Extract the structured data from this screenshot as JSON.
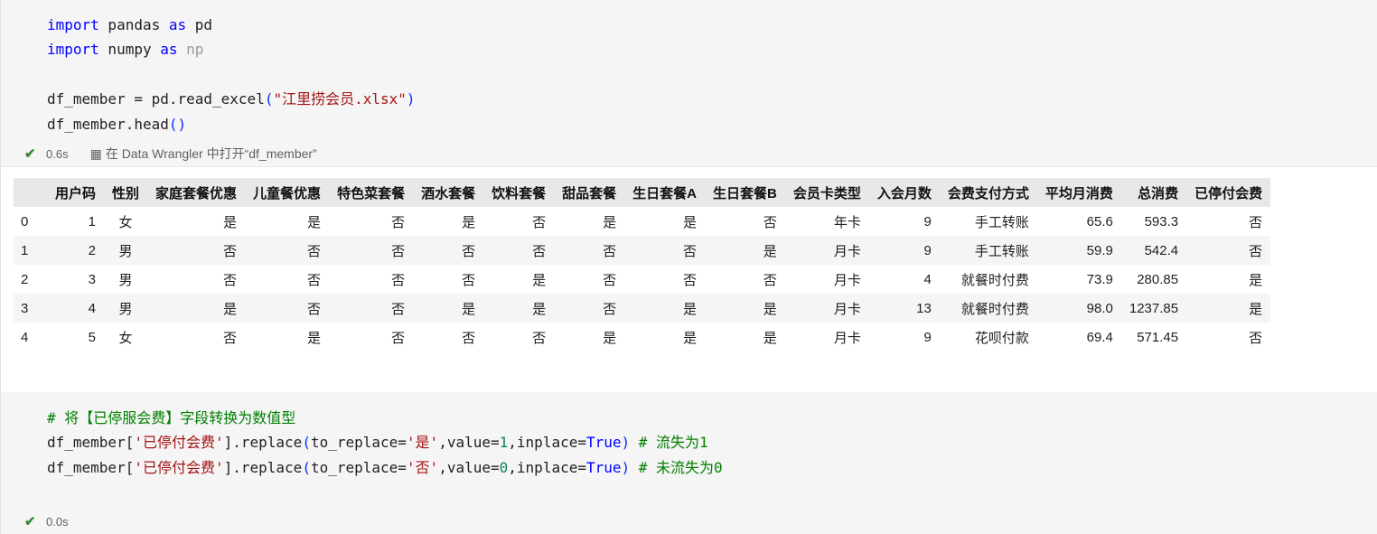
{
  "cell1": {
    "code": {
      "line1": {
        "kw1": "import",
        "mid": " pandas ",
        "kw2": "as",
        "tail": " pd"
      },
      "line2": {
        "kw1": "import",
        "mid": " numpy ",
        "kw2": "as",
        "tail": " np"
      },
      "line4": {
        "pre": "df_member = pd.read_excel",
        "open": "(",
        "str": "\"江里捞会员.xlsx\"",
        "close": ")"
      },
      "line5": {
        "pre": "df_member.head",
        "paren": "()"
      }
    },
    "status": {
      "time": "0.6s",
      "data_wrangler": "在 Data Wrangler 中打开“df_member”"
    }
  },
  "table": {
    "columns": [
      "",
      "用户码",
      "性别",
      "家庭套餐优惠",
      "儿童餐优惠",
      "特色菜套餐",
      "酒水套餐",
      "饮料套餐",
      "甜品套餐",
      "生日套餐A",
      "生日套餐B",
      "会员卡类型",
      "入会月数",
      "会费支付方式",
      "平均月消费",
      "总消费",
      "已停付会费"
    ],
    "rows": [
      [
        "0",
        "1",
        "女",
        "是",
        "是",
        "否",
        "是",
        "否",
        "是",
        "是",
        "否",
        "年卡",
        "9",
        "手工转账",
        "65.6",
        "593.3",
        "否"
      ],
      [
        "1",
        "2",
        "男",
        "否",
        "否",
        "否",
        "否",
        "否",
        "否",
        "否",
        "是",
        "月卡",
        "9",
        "手工转账",
        "59.9",
        "542.4",
        "否"
      ],
      [
        "2",
        "3",
        "男",
        "否",
        "否",
        "否",
        "否",
        "是",
        "否",
        "否",
        "否",
        "月卡",
        "4",
        "就餐时付费",
        "73.9",
        "280.85",
        "是"
      ],
      [
        "3",
        "4",
        "男",
        "是",
        "否",
        "否",
        "是",
        "是",
        "否",
        "是",
        "是",
        "月卡",
        "13",
        "就餐时付费",
        "98.0",
        "1237.85",
        "是"
      ],
      [
        "4",
        "5",
        "女",
        "否",
        "是",
        "否",
        "否",
        "否",
        "是",
        "是",
        "是",
        "月卡",
        "9",
        "花呗付款",
        "69.4",
        "571.45",
        "否"
      ]
    ]
  },
  "cell2": {
    "code": {
      "line1": "# 将【已停服会费】字段转换为数值型",
      "line2": {
        "pre": "df_member[",
        "str": "'已停付会费'",
        "mid": "].replace",
        "open": "(",
        "arg1": "to_replace=",
        "s2": "'是'",
        "arg2": ",value=",
        "n": "1",
        "arg3": ",inplace=",
        "kw": "True",
        "close": ")",
        "cm": " # 流失为1"
      },
      "line3": {
        "pre": "df_member[",
        "str": "'已停付会费'",
        "mid": "].replace",
        "open": "(",
        "arg1": "to_replace=",
        "s2": "'否'",
        "arg2": ",value=",
        "n": "0",
        "arg3": ",inplace=",
        "kw": "True",
        "close": ")",
        "cm": " # 未流失为0"
      }
    },
    "status": {
      "time": "0.0s"
    }
  }
}
